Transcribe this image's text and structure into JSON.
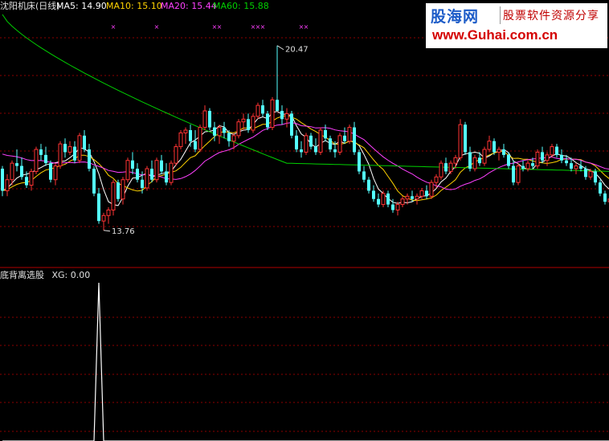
{
  "header": {
    "title": "沈阳机床(日线)",
    "ma5": "MA5: 14.90",
    "ma10": "MA10: 15.10",
    "ma20": "MA20: 15.44",
    "ma60": "MA60: 15.88"
  },
  "indicator": {
    "title": "底背离选股",
    "xg": "XG: 0.00"
  },
  "logo": {
    "name": "股海网",
    "tagline": "股票软件资源分享",
    "url": "www.Guhai.com.cn"
  },
  "colors": {
    "up": "#ff3333",
    "down": "#54ffff",
    "ma5": "#ffffff",
    "ma10": "#ffd200",
    "ma20": "#ff40ff",
    "ma60": "#00d000",
    "grid": "#8b0000",
    "marker": "#ff40ff"
  },
  "chart_data": {
    "type": "candlestick",
    "price_range": [
      12.5,
      21.6
    ],
    "annotations": [
      {
        "label": "20.47",
        "value": 20.47,
        "type": "high"
      },
      {
        "label": "13.76",
        "value": 13.76,
        "type": "low"
      }
    ],
    "candles": [
      [
        16.0,
        16.1,
        15.0,
        15.2
      ],
      [
        15.2,
        15.8,
        15.0,
        15.6
      ],
      [
        15.6,
        16.3,
        15.4,
        16.2
      ],
      [
        16.2,
        16.7,
        15.9,
        16.1
      ],
      [
        16.1,
        16.4,
        15.6,
        15.7
      ],
      [
        15.7,
        15.9,
        15.3,
        15.4
      ],
      [
        15.4,
        16.0,
        15.2,
        15.9
      ],
      [
        15.9,
        16.8,
        15.8,
        16.7
      ],
      [
        16.7,
        16.9,
        16.3,
        16.5
      ],
      [
        16.5,
        16.8,
        16.1,
        16.2
      ],
      [
        16.2,
        16.3,
        15.5,
        15.6
      ],
      [
        15.6,
        16.2,
        15.4,
        16.1
      ],
      [
        16.1,
        17.0,
        16.0,
        16.9
      ],
      [
        16.9,
        17.1,
        16.4,
        16.6
      ],
      [
        16.6,
        17.0,
        16.5,
        16.8
      ],
      [
        16.8,
        17.0,
        16.2,
        16.3
      ],
      [
        16.3,
        17.3,
        16.2,
        17.2
      ],
      [
        17.2,
        17.4,
        16.6,
        16.7
      ],
      [
        16.7,
        16.9,
        15.9,
        16.0
      ],
      [
        16.0,
        16.1,
        15.0,
        15.1
      ],
      [
        15.1,
        15.3,
        14.0,
        14.1
      ],
      [
        14.1,
        14.4,
        13.76,
        14.3
      ],
      [
        14.3,
        14.6,
        14.0,
        14.5
      ],
      [
        14.5,
        15.6,
        14.3,
        15.5
      ],
      [
        15.5,
        15.6,
        14.8,
        14.9
      ],
      [
        14.9,
        15.7,
        14.7,
        15.6
      ],
      [
        15.6,
        16.4,
        15.5,
        16.3
      ],
      [
        16.3,
        16.6,
        15.8,
        16.0
      ],
      [
        16.0,
        16.2,
        15.5,
        15.6
      ],
      [
        15.6,
        15.9,
        15.1,
        15.3
      ],
      [
        15.3,
        16.1,
        15.2,
        16.0
      ],
      [
        16.0,
        16.3,
        15.5,
        15.6
      ],
      [
        15.6,
        16.4,
        15.5,
        16.3
      ],
      [
        16.3,
        16.5,
        15.8,
        15.9
      ],
      [
        15.9,
        16.2,
        15.4,
        15.5
      ],
      [
        15.5,
        16.3,
        15.4,
        16.2
      ],
      [
        16.2,
        16.9,
        16.1,
        16.8
      ],
      [
        16.8,
        17.4,
        16.7,
        17.3
      ],
      [
        17.3,
        17.5,
        16.9,
        17.4
      ],
      [
        17.4,
        17.6,
        16.8,
        17.0
      ],
      [
        17.0,
        17.4,
        16.6,
        16.7
      ],
      [
        16.7,
        17.6,
        16.6,
        17.5
      ],
      [
        17.5,
        18.3,
        17.4,
        18.1
      ],
      [
        18.1,
        18.2,
        17.4,
        17.5
      ],
      [
        17.5,
        17.7,
        17.0,
        17.2
      ],
      [
        17.2,
        17.6,
        16.9,
        17.5
      ],
      [
        17.5,
        17.7,
        17.1,
        17.3
      ],
      [
        17.3,
        17.4,
        16.8,
        17.0
      ],
      [
        17.0,
        17.3,
        16.7,
        17.2
      ],
      [
        17.2,
        17.8,
        17.1,
        17.7
      ],
      [
        17.7,
        18.0,
        17.4,
        17.8
      ],
      [
        17.8,
        18.0,
        17.3,
        17.4
      ],
      [
        17.4,
        18.0,
        17.3,
        17.9
      ],
      [
        17.9,
        18.4,
        17.8,
        18.3
      ],
      [
        18.3,
        18.5,
        17.9,
        18.0
      ],
      [
        18.0,
        18.1,
        17.4,
        17.5
      ],
      [
        17.5,
        18.6,
        17.4,
        18.5
      ],
      [
        18.5,
        20.47,
        18.3,
        18.1
      ],
      [
        18.1,
        18.3,
        17.6,
        17.8
      ],
      [
        17.8,
        18.2,
        17.5,
        18.0
      ],
      [
        18.0,
        18.1,
        17.1,
        17.2
      ],
      [
        17.2,
        17.4,
        16.6,
        16.7
      ],
      [
        16.7,
        17.0,
        16.4,
        16.6
      ],
      [
        16.6,
        17.3,
        16.5,
        17.2
      ],
      [
        17.2,
        17.3,
        16.7,
        16.8
      ],
      [
        16.8,
        17.1,
        16.5,
        16.6
      ],
      [
        16.6,
        17.5,
        16.5,
        17.4
      ],
      [
        17.4,
        17.6,
        17.0,
        17.1
      ],
      [
        17.1,
        17.2,
        16.6,
        16.7
      ],
      [
        16.7,
        17.0,
        16.4,
        16.6
      ],
      [
        16.6,
        17.3,
        16.5,
        17.2
      ],
      [
        17.2,
        17.5,
        16.9,
        17.0
      ],
      [
        17.0,
        17.6,
        16.9,
        17.5
      ],
      [
        17.5,
        17.7,
        16.5,
        16.6
      ],
      [
        16.6,
        16.7,
        15.8,
        15.9
      ],
      [
        15.9,
        16.1,
        15.5,
        15.6
      ],
      [
        15.6,
        15.7,
        15.1,
        15.2
      ],
      [
        15.2,
        15.4,
        14.8,
        14.9
      ],
      [
        14.9,
        15.1,
        14.6,
        14.7
      ],
      [
        14.7,
        15.2,
        14.6,
        15.1
      ],
      [
        15.1,
        15.2,
        14.6,
        14.7
      ],
      [
        14.7,
        14.9,
        14.4,
        14.5
      ],
      [
        14.5,
        14.8,
        14.3,
        14.7
      ],
      [
        14.7,
        15.0,
        14.6,
        14.9
      ],
      [
        14.9,
        15.1,
        14.7,
        15.0
      ],
      [
        15.0,
        15.2,
        14.8,
        14.9
      ],
      [
        14.9,
        15.1,
        14.7,
        15.0
      ],
      [
        15.0,
        15.3,
        14.9,
        15.2
      ],
      [
        15.2,
        15.4,
        14.9,
        15.0
      ],
      [
        15.0,
        15.6,
        14.9,
        15.5
      ],
      [
        15.5,
        15.8,
        15.3,
        15.7
      ],
      [
        15.7,
        16.3,
        15.6,
        16.2
      ],
      [
        16.2,
        16.4,
        15.8,
        15.9
      ],
      [
        15.9,
        16.3,
        15.8,
        16.2
      ],
      [
        16.2,
        16.5,
        16.0,
        16.4
      ],
      [
        16.4,
        17.8,
        16.3,
        17.6
      ],
      [
        17.6,
        17.7,
        16.5,
        16.6
      ],
      [
        16.6,
        16.8,
        15.9,
        16.0
      ],
      [
        16.0,
        16.5,
        15.9,
        16.4
      ],
      [
        16.4,
        16.6,
        16.1,
        16.2
      ],
      [
        16.2,
        16.8,
        16.1,
        16.7
      ],
      [
        16.7,
        17.2,
        16.6,
        17.0
      ],
      [
        17.0,
        17.1,
        16.5,
        16.6
      ],
      [
        16.6,
        16.8,
        16.3,
        16.7
      ],
      [
        16.7,
        16.9,
        16.4,
        16.5
      ],
      [
        16.5,
        16.6,
        16.0,
        16.1
      ],
      [
        16.1,
        16.3,
        15.4,
        15.5
      ],
      [
        15.5,
        16.2,
        15.4,
        16.1
      ],
      [
        16.1,
        16.3,
        15.9,
        16.0
      ],
      [
        16.0,
        16.3,
        15.9,
        16.2
      ],
      [
        16.2,
        16.4,
        16.0,
        16.1
      ],
      [
        16.1,
        16.7,
        16.0,
        16.6
      ],
      [
        16.6,
        16.8,
        16.2,
        16.3
      ],
      [
        16.3,
        16.6,
        16.1,
        16.5
      ],
      [
        16.5,
        16.9,
        16.4,
        16.8
      ],
      [
        16.8,
        16.9,
        16.4,
        16.5
      ],
      [
        16.5,
        16.7,
        16.2,
        16.3
      ],
      [
        16.3,
        16.5,
        16.1,
        16.2
      ],
      [
        16.2,
        16.4,
        15.9,
        16.0
      ],
      [
        16.0,
        16.2,
        15.8,
        16.1
      ],
      [
        16.1,
        16.3,
        15.9,
        16.0
      ],
      [
        16.0,
        16.1,
        15.6,
        15.7
      ],
      [
        15.7,
        16.0,
        15.6,
        15.9
      ],
      [
        15.9,
        16.0,
        15.4,
        15.5
      ],
      [
        15.5,
        15.6,
        15.0,
        15.1
      ],
      [
        15.1,
        15.2,
        14.7,
        14.8
      ],
      [
        14.8,
        15.0,
        14.6,
        14.9
      ],
      [
        14.9,
        15.0,
        14.6,
        14.7
      ],
      [
        14.7,
        14.9,
        14.6,
        14.8
      ],
      [
        14.8,
        15.0,
        14.7,
        14.9
      ],
      [
        14.9,
        15.2,
        14.8,
        15.1
      ],
      [
        15.1,
        15.3,
        14.9,
        15.0
      ]
    ],
    "ma60_from": 16.0,
    "indicator_values": [
      0,
      0,
      0,
      0,
      0,
      0,
      0,
      0,
      0,
      0,
      0,
      0,
      0,
      0,
      0,
      0,
      0,
      0,
      0,
      0,
      1,
      0,
      0,
      0,
      0,
      0,
      0,
      0,
      0,
      0,
      0,
      0,
      0,
      0,
      0,
      0,
      0,
      0,
      0,
      0,
      0,
      0,
      0,
      0,
      0,
      0,
      0,
      0,
      0,
      0,
      0,
      0,
      0,
      0,
      0,
      0,
      0,
      0,
      0,
      0,
      0,
      0,
      0,
      0,
      0,
      0,
      0,
      0,
      0,
      0,
      0,
      0,
      0,
      0,
      0,
      0,
      0,
      0,
      0,
      0,
      0,
      0,
      0,
      0,
      0,
      0,
      0,
      0,
      0,
      0,
      0,
      0,
      0,
      0,
      0,
      0,
      0,
      0,
      0,
      0,
      0,
      0,
      0,
      0,
      0,
      0,
      0,
      0,
      0,
      0,
      0,
      0,
      0,
      0,
      0,
      0,
      0,
      0,
      0,
      0,
      0,
      0,
      0,
      0,
      0,
      0,
      0,
      0,
      0,
      0,
      0,
      0
    ]
  }
}
